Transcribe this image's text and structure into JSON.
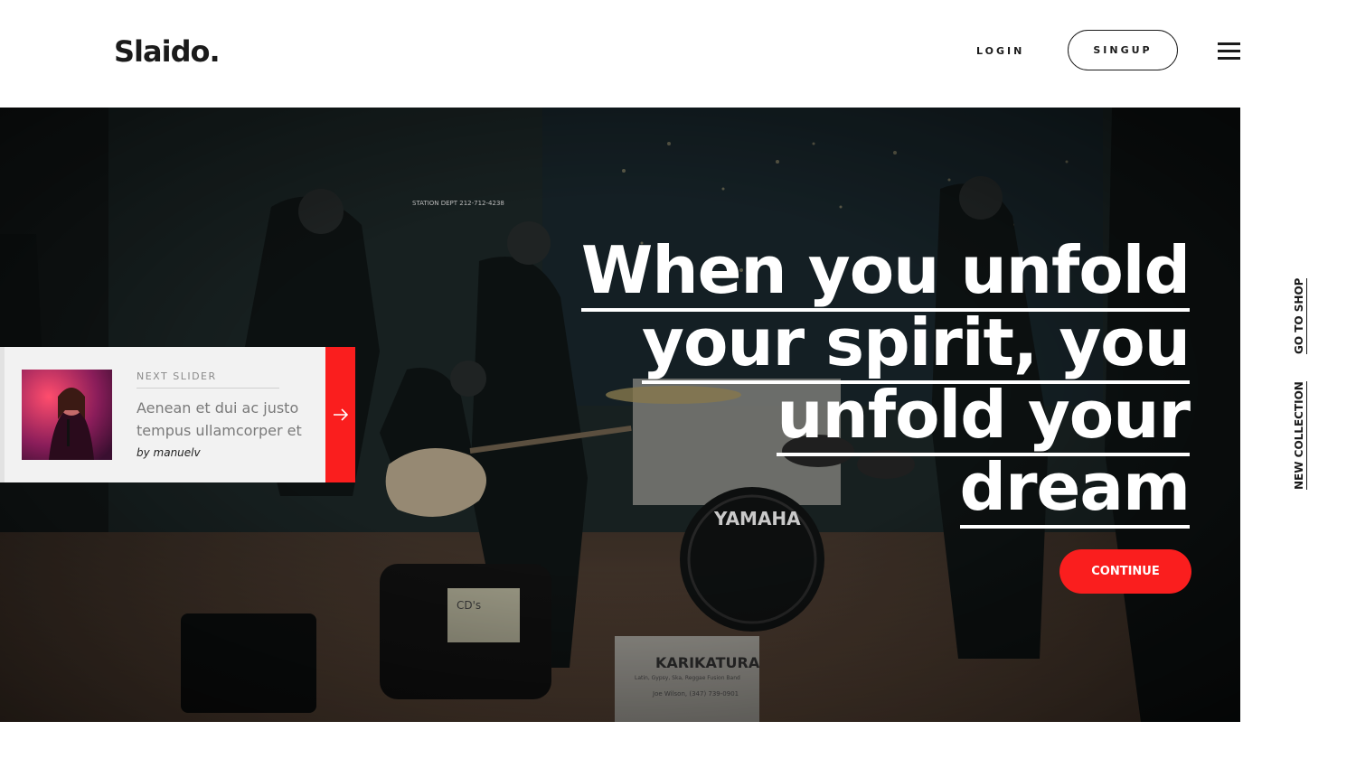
{
  "header": {
    "logo": "Slaido.",
    "login_label": "LOGIN",
    "signup_label": "SINGUP"
  },
  "hero": {
    "headline_lines": [
      "When you unfold",
      "your spirit, you",
      "unfold your",
      "dream"
    ],
    "continue_label": "CONTINUE",
    "photo_texts": {
      "station": "STATION DEPT 212-712-4238",
      "drum": "YAMAHA",
      "sign_title": "KARIKATURA",
      "sign_sub": "Latin, Gypsy, Ska, Reggae Fusion Band",
      "sign_contact": "Joe Wilson, (347) 739-0901",
      "cd_sign": "CD's"
    }
  },
  "next_slider": {
    "label": "NEXT SLIDER",
    "title": "Aenean et dui ac justo tempus ullamcorper et",
    "author": "by manuelv"
  },
  "side_links": {
    "shop": "GO TO SHOP",
    "collection": "NEW COLLECTION"
  },
  "colors": {
    "accent": "#fa1e1e",
    "text_dark": "#1b1b1b",
    "card_bg": "#f2f2f2"
  }
}
